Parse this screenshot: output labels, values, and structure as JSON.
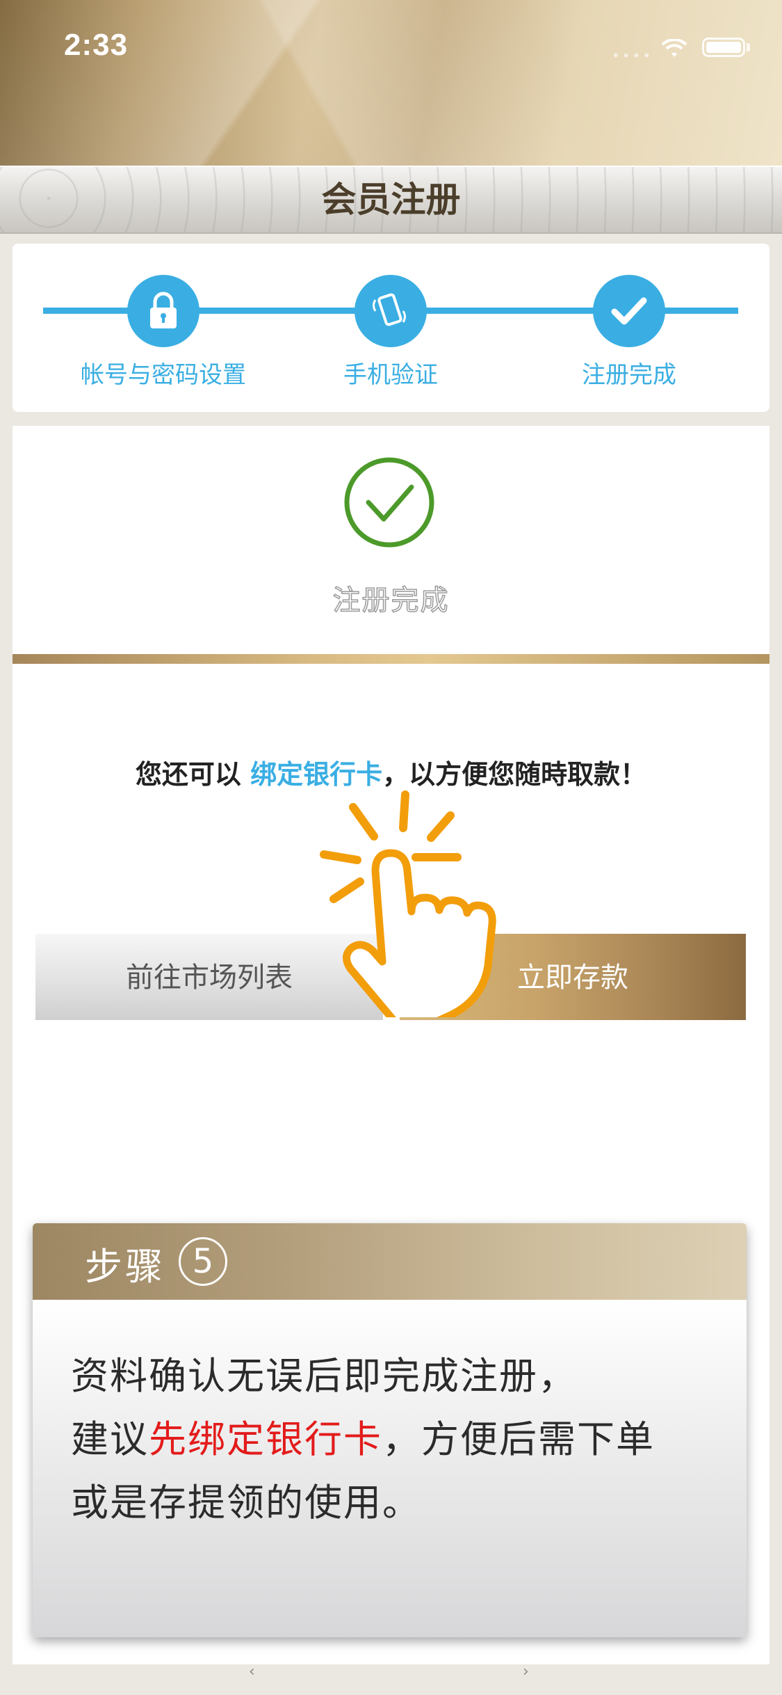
{
  "status_bar": {
    "time": "2:33",
    "signal": "•••• "
  },
  "header": {
    "title": "会员注册"
  },
  "steps": [
    {
      "label": "帐号与密码设置",
      "icon": "lock-icon"
    },
    {
      "label": "手机验证",
      "icon": "phone-icon"
    },
    {
      "label": "注册完成",
      "icon": "check-icon"
    }
  ],
  "result": {
    "status_text": "注册完成"
  },
  "bind": {
    "prefix": "您还可以 ",
    "link": "绑定银行卡",
    "suffix": "，以方便您随時取款！"
  },
  "buttons": {
    "market": "前往市场列表",
    "deposit": "立即存款"
  },
  "tooltip": {
    "title": "步骤",
    "step_number": "5",
    "line1": "资料确认无误后即完成注册，",
    "line2_prefix": "建议",
    "line2_highlight": "先绑定银行卡",
    "line2_suffix": "，方便后需下单",
    "line3": "或是存提领的使用。"
  },
  "nav": {
    "back": "‹",
    "forward": "›"
  },
  "colors": {
    "accent_blue": "#3aaee3",
    "success_green": "#4c9a2a",
    "gold": "#c7a36a",
    "highlight_red": "#e31b1b",
    "hand_orange": "#f29d0a"
  }
}
